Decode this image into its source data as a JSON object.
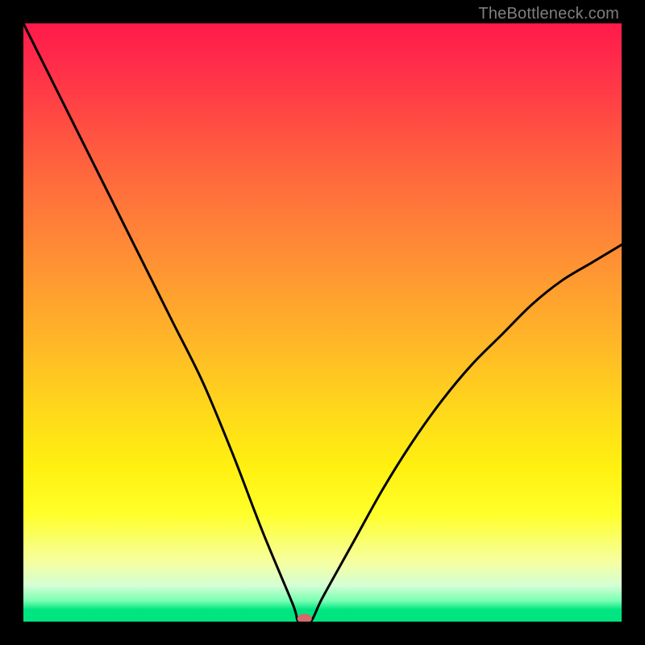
{
  "watermark": {
    "text": "TheBottleneck.com"
  },
  "chart_data": {
    "type": "line",
    "title": "",
    "xlabel": "",
    "ylabel": "",
    "xlim": [
      0,
      100
    ],
    "ylim": [
      0,
      100
    ],
    "grid": false,
    "legend": false,
    "series": [
      {
        "name": "bottleneck-curve",
        "x": [
          0,
          5,
          10,
          15,
          20,
          25,
          30,
          35,
          40,
          45,
          46,
          48,
          50,
          55,
          60,
          65,
          70,
          75,
          80,
          85,
          90,
          95,
          100
        ],
        "values": [
          100,
          90,
          80,
          70,
          60,
          50,
          40,
          28,
          15,
          3,
          0,
          0,
          4,
          13,
          22,
          30,
          37,
          43,
          48,
          53,
          57,
          60,
          63
        ]
      }
    ],
    "marker": {
      "x": 47,
      "y": 0.5,
      "color": "#d46a6a"
    },
    "gradient_stops": [
      {
        "pos": 0.0,
        "color": "#ff1a4a"
      },
      {
        "pos": 0.5,
        "color": "#ffc020"
      },
      {
        "pos": 0.82,
        "color": "#ffff2a"
      },
      {
        "pos": 0.96,
        "color": "#7affb4"
      },
      {
        "pos": 1.0,
        "color": "#00e580"
      }
    ]
  }
}
